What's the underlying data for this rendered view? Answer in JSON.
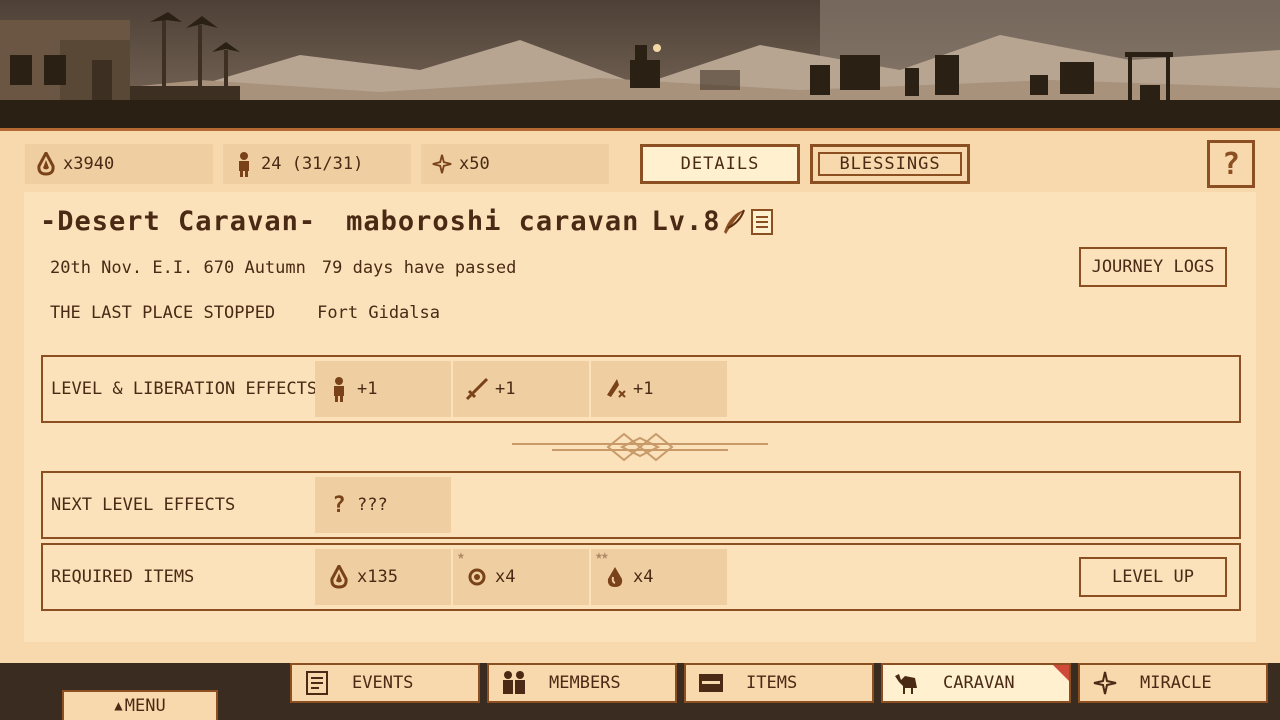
{
  "colors": {
    "accent": "#8c4f22",
    "panel": "#f7d9ad",
    "chip": "#efcfa1",
    "text": "#4a2a14",
    "notify": "#d04a3a"
  },
  "stats": {
    "water": "x3940",
    "members": "24 (31/31)",
    "miracle": "x50"
  },
  "tabs": {
    "details": "DETAILS",
    "blessings": "BLESSINGS"
  },
  "help": {
    "label": "?"
  },
  "caravan": {
    "prefix": "-Desert Caravan-",
    "name": "maboroshi caravan",
    "level": "Lv.8"
  },
  "date": {
    "text": "20th Nov. E.I. 670 Autumn",
    "elapsed": "79 days have passed"
  },
  "last_place": {
    "label": "THE LAST PLACE STOPPED",
    "value": "Fort Gidalsa"
  },
  "journey_logs": "JOURNEY LOGS",
  "liberation": {
    "label": "LEVEL & LIBERATION EFFECTS",
    "effects": [
      {
        "icon": "member-icon",
        "value": "+1"
      },
      {
        "icon": "sword-icon",
        "value": "+1"
      },
      {
        "icon": "boot-icon",
        "value": "+1"
      }
    ]
  },
  "next_level": {
    "label": "NEXT LEVEL EFFECTS",
    "effects": [
      {
        "icon": "question-icon",
        "value": "???"
      }
    ]
  },
  "required": {
    "label": "REQUIRED ITEMS",
    "items": [
      {
        "icon": "water-drop-icon",
        "value": "x135",
        "stars": ""
      },
      {
        "icon": "gem-icon",
        "value": "x4",
        "stars": "★"
      },
      {
        "icon": "oil-drop-icon",
        "value": "x4",
        "stars": "★★"
      }
    ]
  },
  "level_up": "LEVEL UP",
  "nav": {
    "events": "EVENTS",
    "members": "MEMBERS",
    "items": "ITEMS",
    "caravan": "CARAVAN",
    "miracle": "MIRACLE"
  },
  "menu": "MENU"
}
